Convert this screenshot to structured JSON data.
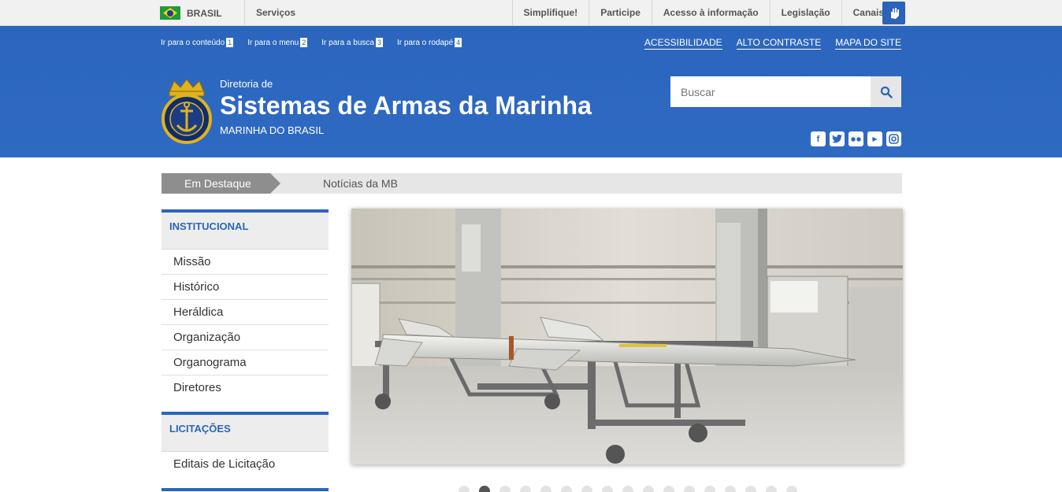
{
  "govbar": {
    "country": "BRASIL",
    "services": "Serviços",
    "links": [
      "Simplifique!",
      "Participe",
      "Acesso à informação",
      "Legislação",
      "Canais"
    ]
  },
  "header": {
    "skip_links": [
      {
        "label": "Ir para o conteúdo",
        "key": "1"
      },
      {
        "label": "Ir para o menu",
        "key": "2"
      },
      {
        "label": "Ir para a busca",
        "key": "3"
      },
      {
        "label": "Ir para o rodapé",
        "key": "4"
      }
    ],
    "accessibility": [
      "ACESSIBILIDADE",
      "ALTO CONTRASTE",
      "MAPA DO SITE"
    ],
    "pre_title": "Diretoria de",
    "title": "Sistemas de Armas da Marinha",
    "subtitle": "MARINHA DO BRASIL",
    "logo_text": "MARINHA DO BRASIL",
    "search_placeholder": "Buscar",
    "social_icons": [
      "facebook-icon",
      "twitter-icon",
      "flickr-icon",
      "youtube-icon",
      "instagram-icon"
    ]
  },
  "destaque": {
    "tag": "Em Destaque",
    "news": "Notícias da MB"
  },
  "sidebar": {
    "sections": [
      {
        "title": "INSTITUCIONAL",
        "items": [
          "Missão",
          "Histórico",
          "Heráldica",
          "Organização",
          "Organograma",
          "Diretores"
        ]
      },
      {
        "title": "LICITAÇÕES",
        "items": [
          "Editais de Licitação"
        ]
      }
    ]
  },
  "carousel": {
    "image": "missile-on-trolley",
    "active_slide": 2,
    "slide_count": 17
  },
  "colors": {
    "brand_blue": "#2b65bd",
    "gov_gray": "#f1f1f1"
  }
}
